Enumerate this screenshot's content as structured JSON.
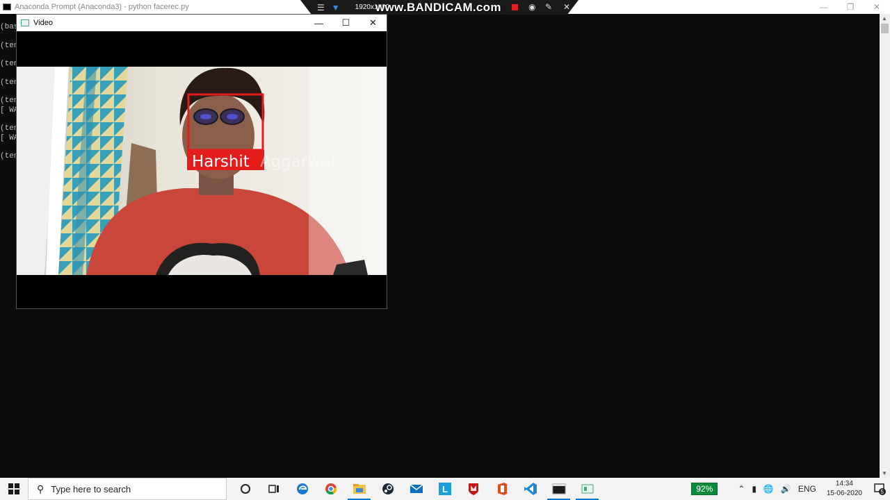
{
  "console": {
    "title": "Anaconda Prompt (Anaconda3) - python  facerec.py",
    "lines": [
      "(bas",
      "",
      "(ten",
      "",
      "(ten",
      "",
      "(ten",
      "",
      "(ten",
      "[ WA",
      "",
      "(ten",
      "[ WA",
      "",
      "(ten"
    ]
  },
  "bandicam": {
    "resolution": "1920x1080",
    "watermark": "www.BANDICAM.com"
  },
  "video": {
    "title": "Video",
    "face_label": "Harshit",
    "face_label_rest": " Aggarwal",
    "box_color": "#e41c1c"
  },
  "taskbar": {
    "search_placeholder": "Type here to search",
    "battery": "92%",
    "language": "ENG",
    "time": "14:34",
    "date": "15-06-2020",
    "notification_count": "5",
    "apps": [
      "cortana-icon",
      "task-view-icon",
      "edge-icon",
      "chrome-icon",
      "file-explorer-icon",
      "steam-icon",
      "mail-icon",
      "l-app-icon",
      "mcafee-icon",
      "office-icon",
      "vscode-icon",
      "terminal-icon",
      "video-app-icon"
    ]
  }
}
